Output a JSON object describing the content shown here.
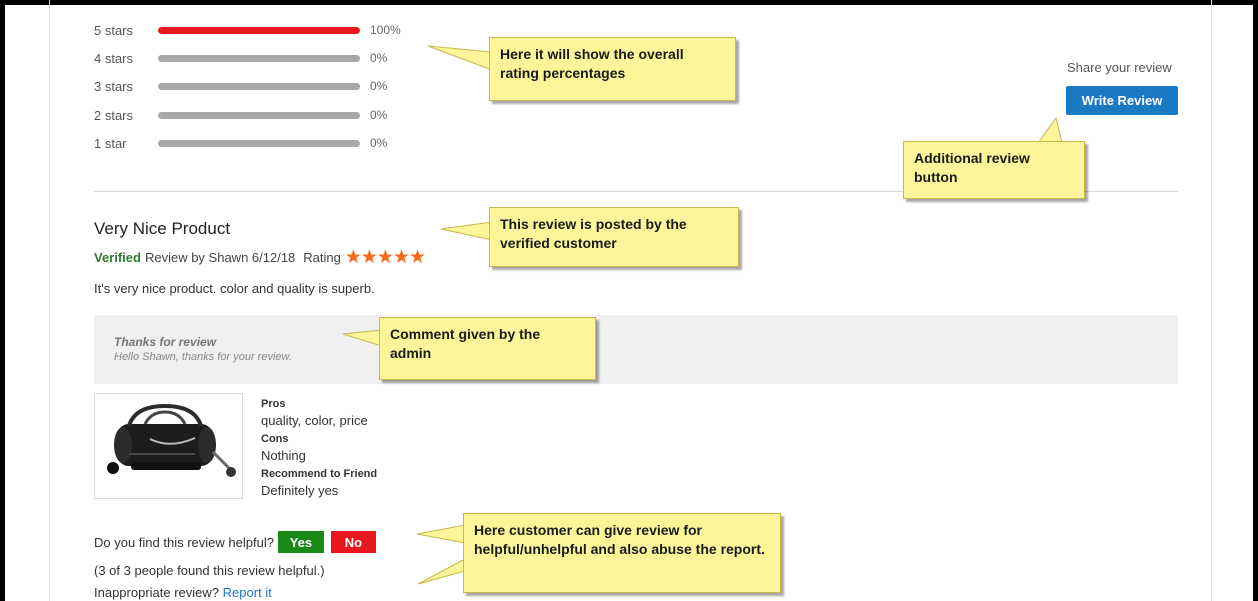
{
  "ratings": {
    "rows": [
      {
        "label": "5 stars",
        "pct_text": "100%",
        "pct": 100
      },
      {
        "label": "4 stars",
        "pct_text": "0%",
        "pct": 0
      },
      {
        "label": "3 stars",
        "pct_text": "0%",
        "pct": 0
      },
      {
        "label": "2 stars",
        "pct_text": "0%",
        "pct": 0
      },
      {
        "label": "1 star",
        "pct_text": "0%",
        "pct": 0
      }
    ]
  },
  "share": {
    "label": "Share your review",
    "button": "Write Review"
  },
  "review": {
    "title": "Very Nice Product",
    "verified": "Verified",
    "byline": "Review by Shawn 6/12/18",
    "rating_label": "Rating",
    "stars_glyph": "★★★★★",
    "stars": 5,
    "body": "It's very nice product. color and quality is superb.",
    "admin_title": "Thanks for review",
    "admin_text": "Hello Shawn, thanks for your review.",
    "pros_label": "Pros",
    "pros": "quality, color, price",
    "cons_label": "Cons",
    "cons": "Nothing",
    "recommend_label": "Recommend to Friend",
    "recommend": "Definitely yes",
    "image_icon": "duffel-bag-icon"
  },
  "helpful": {
    "question": "Do you find this review helpful?",
    "yes": "Yes",
    "no": "No",
    "count_text": "(3 of 3 people found this review helpful.)",
    "report_prompt": "Inappropriate review?",
    "report_link": "Report it"
  },
  "callouts": {
    "rating": "Here it will show the overall rating percentages",
    "write": "Additional review button",
    "verified": "This review is posted by the verified customer",
    "admin": "Comment given by the admin",
    "helpful": "Here customer can give review for helpful/unhelpful and also abuse the report."
  },
  "colors": {
    "accent_blue": "#1979c3",
    "bar_red": "#e8171e",
    "bar_gray": "#a8a8a8",
    "verified_green": "#2e7d32",
    "star_orange": "#f26c1d",
    "callout_yellow": "#fdf59a"
  }
}
